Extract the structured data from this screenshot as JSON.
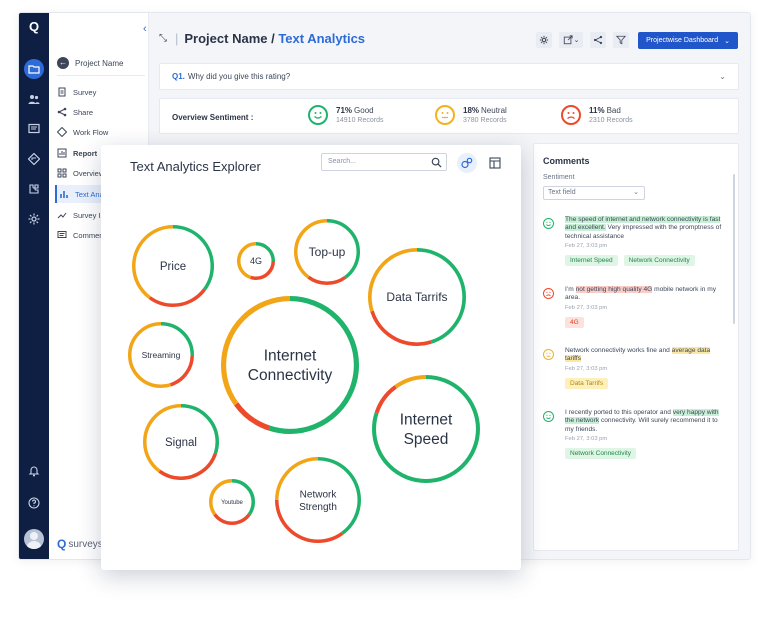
{
  "sidebar": {
    "project_label": "Project Name",
    "items": [
      {
        "label": "Survey",
        "icon": "document-icon"
      },
      {
        "label": "Share",
        "icon": "share-icon"
      },
      {
        "label": "Work Flow",
        "icon": "workflow-icon"
      },
      {
        "label": "Report",
        "icon": "report-icon"
      },
      {
        "label": "Overview",
        "icon": "grid-icon"
      },
      {
        "label": "Text Analytics",
        "icon": "bar-chart-icon"
      },
      {
        "label": "Survey Insights",
        "icon": "trend-icon"
      },
      {
        "label": "Comments",
        "icon": "comment-icon"
      }
    ],
    "brand": "surveysparrow"
  },
  "header": {
    "project": "Project Name",
    "page": "Text Analytics",
    "dashboard_button": "Projectwise Dashboard"
  },
  "question": {
    "number": "Q1.",
    "text": "Why did you give this rating?"
  },
  "sentiment": {
    "label": "Overview Sentiment :",
    "items": [
      {
        "pct": "71%",
        "name": "Good",
        "records": "14910 Records",
        "color": "#1fb36b"
      },
      {
        "pct": "18%",
        "name": "Neutral",
        "records": "3780 Records",
        "color": "#f2b21b"
      },
      {
        "pct": "11%",
        "name": "Bad",
        "records": "2310 Records",
        "color": "#ec4a2b"
      }
    ]
  },
  "explorer": {
    "title": "Text Analytics Explorer",
    "search_placeholder": "Search...",
    "topics": [
      {
        "label": "Price",
        "share": {
          "green": 0.35,
          "red": 0.25,
          "orange": 0.4
        }
      },
      {
        "label": "4G",
        "share": {
          "green": 0.25,
          "red": 0.3,
          "orange": 0.45
        }
      },
      {
        "label": "Top-up",
        "share": {
          "green": 0.4,
          "red": 0.2,
          "orange": 0.4
        }
      },
      {
        "label": "Data Tarrifs",
        "share": {
          "green": 0.45,
          "red": 0.25,
          "orange": 0.3
        }
      },
      {
        "label": "Streaming",
        "share": {
          "green": 0.25,
          "red": 0.2,
          "orange": 0.55
        }
      },
      {
        "label": "Internet Connectivity",
        "share": {
          "green": 0.55,
          "red": 0.1,
          "orange": 0.35
        }
      },
      {
        "label": "Internet Speed",
        "share": {
          "green": 0.8,
          "red": 0.1,
          "orange": 0.1
        }
      },
      {
        "label": "Signal",
        "share": {
          "green": 0.3,
          "red": 0.3,
          "orange": 0.4
        }
      },
      {
        "label": "Youtube",
        "share": {
          "green": 0.35,
          "red": 0.3,
          "orange": 0.35
        }
      },
      {
        "label": "Network Strength",
        "share": {
          "green": 0.4,
          "red": 0.35,
          "orange": 0.25
        }
      }
    ]
  },
  "comments": {
    "title": "Comments",
    "filter_label": "Sentiment",
    "filter_value": "Text field",
    "items": [
      {
        "sentiment": "good",
        "parts": [
          {
            "text": "The speed of internet and network connectivity is fast and excellent.",
            "hl": "g"
          },
          {
            "text": " Very impressed with the promptness of technical assistance",
            "hl": ""
          }
        ],
        "date": "Feb 27, 3:03 pm",
        "tags": [
          {
            "label": "Internet Speed",
            "tone": "g"
          },
          {
            "label": "Network Connectivity",
            "tone": "g"
          }
        ]
      },
      {
        "sentiment": "bad",
        "parts": [
          {
            "text": "I’m ",
            "hl": ""
          },
          {
            "text": "not getting high quality 4G",
            "hl": "r"
          },
          {
            "text": " mobile network in my area.",
            "hl": ""
          }
        ],
        "date": "Feb 27, 3:03 pm",
        "tags": [
          {
            "label": "4G",
            "tone": "r"
          }
        ]
      },
      {
        "sentiment": "neutral",
        "parts": [
          {
            "text": "Network connectivity works fine and ",
            "hl": ""
          },
          {
            "text": "average data tariffs",
            "hl": "y"
          }
        ],
        "date": "Feb 27, 3:03 pm",
        "tags": [
          {
            "label": "Data Tarrifs",
            "tone": "y"
          }
        ]
      },
      {
        "sentiment": "good",
        "parts": [
          {
            "text": "I recently ported to this operator and ",
            "hl": ""
          },
          {
            "text": "very happy with the network",
            "hl": "g"
          },
          {
            "text": " connectivity. Will surely recommend it to my friends.",
            "hl": ""
          }
        ],
        "date": "Feb 27, 3:03 pm",
        "tags": [
          {
            "label": "Network Connectivity",
            "tone": "g"
          }
        ]
      }
    ]
  },
  "colors": {
    "green": "#1fb36b",
    "orange": "#f2a516",
    "red": "#ec4a2b",
    "accent": "#2e6bd6",
    "rail": "#0f1f44"
  }
}
